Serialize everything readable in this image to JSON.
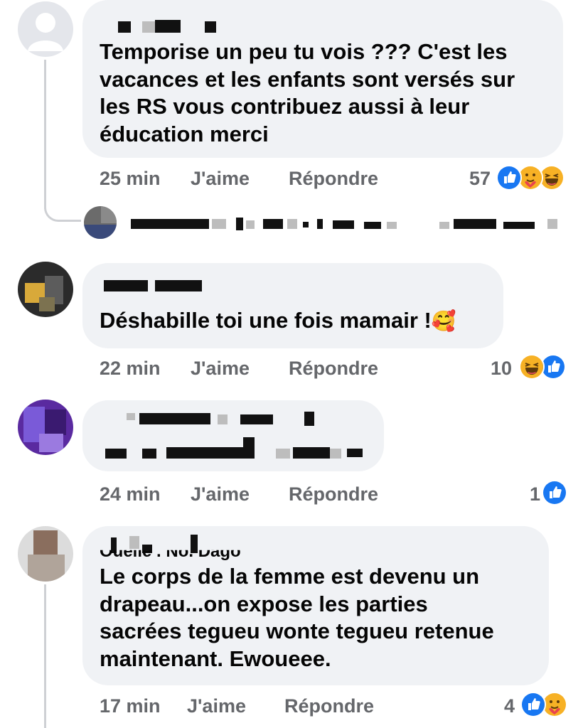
{
  "comments": [
    {
      "text": "Temporise un peu tu vois ??? C'est les\nvacances et les enfants sont versés sur\nles RS vous contribuez aussi à leur\néducation merci",
      "time": "25 min",
      "like_label": "J'aime",
      "reply_label": "Répondre",
      "reaction_count": "57",
      "reactions": [
        "like-icon",
        "care-icon",
        "haha-icon"
      ]
    },
    {
      "text": "Déshabille toi une fois mamair !",
      "emoji": "🥰",
      "time": "22 min",
      "like_label": "J'aime",
      "reply_label": "Répondre",
      "reaction_count": "10",
      "reactions": [
        "haha-icon",
        "like-icon"
      ]
    },
    {
      "text": "",
      "time": "24 min",
      "like_label": "J'aime",
      "reply_label": "Répondre",
      "reaction_count": "1",
      "reactions": [
        "like-icon"
      ]
    },
    {
      "author_partial": "Ouelle . No. Dago",
      "text": "Le corps de la femme est devenu un\ndrapeau...on expose les parties\nsacrées tegueu wonte tegueu retenue\nmaintenant. Ewoueee.",
      "time": "17 min",
      "like_label": "J'aime",
      "reply_label": "Répondre",
      "reaction_count": "4",
      "reactions": [
        "like-icon",
        "care-icon"
      ]
    }
  ],
  "colors": {
    "bubble": "#f0f2f5",
    "meta": "#65676b",
    "like_blue": "#1877f2",
    "reaction_yellow": "#f7b125"
  }
}
